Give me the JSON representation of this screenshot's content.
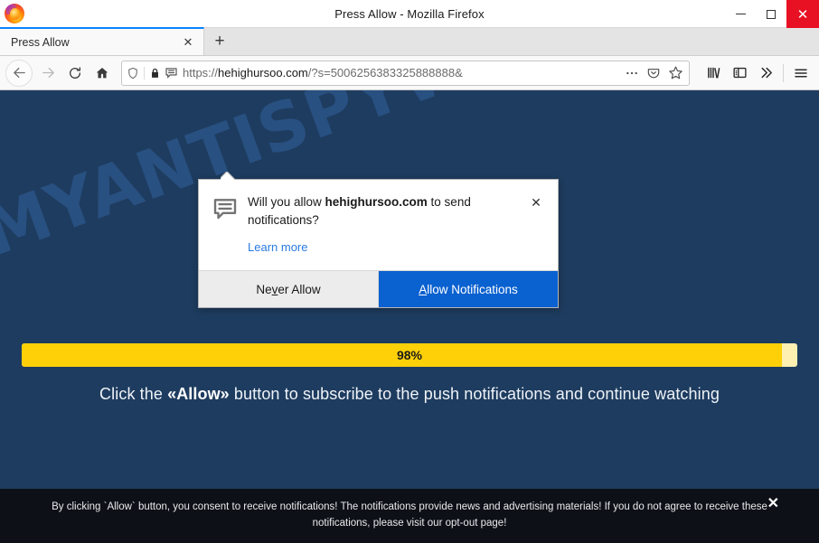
{
  "window": {
    "title": "Press Allow - Mozilla Firefox",
    "logo_icon": "firefox-logo",
    "controls": {
      "minimize": "minimize-icon",
      "maximize": "maximize-icon",
      "close_label": "✕"
    }
  },
  "tabs": {
    "items": [
      {
        "label": "Press Allow",
        "close_label": "✕",
        "active": true
      }
    ],
    "new_tab_label": "+"
  },
  "toolbar": {
    "back_icon": "back-arrow-icon",
    "forward_icon": "forward-arrow-icon",
    "reload_icon": "reload-icon",
    "home_icon": "home-icon",
    "url": {
      "scheme": "https://",
      "host": "hehighursoo.com",
      "path_query": "/?s=5006256383325888888&",
      "full": "https://hehighursoo.com/?s=5006256383325888888&",
      "shield_icon": "tracking-protection-shield-icon",
      "lock_icon": "padlock-icon",
      "permission_icon": "notification-bubble-icon",
      "page_actions_icon": "ellipsis-icon",
      "pocket_icon": "pocket-icon",
      "bookmark_icon": "star-icon"
    },
    "right_icons": [
      {
        "name": "library-icon"
      },
      {
        "name": "sidebar-icon"
      },
      {
        "name": "overflow-chevrons-icon"
      },
      {
        "name": "hamburger-menu-icon"
      }
    ]
  },
  "doorhanger": {
    "icon": "notification-bubble-icon",
    "question_prefix": "Will you allow ",
    "question_domain": "hehighursoo.com",
    "question_suffix": " to send notifications?",
    "learn_more": "Learn more",
    "close_label": "✕",
    "never_allow": {
      "pre": "Ne",
      "key": "v",
      "post": "er Allow"
    },
    "allow": {
      "pre": "",
      "key": "A",
      "post": "llow Notifications"
    },
    "primary_color": "#0a61d0"
  },
  "page": {
    "background_color": "#1e3c5f",
    "watermark": "MYANTISPYWARE.COM",
    "progress": {
      "percent": 98,
      "label": "98%",
      "fill_color": "#fdd008",
      "track_color": "#fdf0b0"
    },
    "cta": {
      "before": "Click the ",
      "highlight": "«Allow»",
      "after": " button to subscribe to the push notifications and continue watching"
    },
    "bottom_banner": {
      "line1": "By clicking `Allow` button, you consent to receive notifications! The notifications provide news and advertising materials! If you do not agree to receive",
      "line2_before": "these notifications, please visit our ",
      "line2_link": "opt-out page",
      "line2_after": "!",
      "close_label": "✕",
      "background_color": "#0d1117"
    }
  }
}
